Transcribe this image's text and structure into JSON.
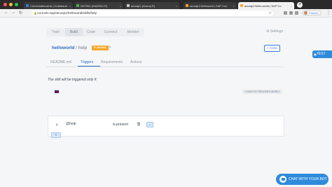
{
  "browser": {
    "tabs": [
      {
        "title": "Conversational AI | Collaborat",
        "color": "#3a7bd5"
      },
      {
        "title": "I327904 (ANURAJ R)",
        "color": "#4caf50"
      },
      {
        "title": "anurajr1 (Anuraj R)",
        "color": "#cccccc"
      },
      {
        "title": "anurajr1/helloworld | SAP Con",
        "color": "#f4a72a"
      },
      {
        "title": "anurajr1/hello-world | SAP Co",
        "color": "#f4a72a"
      }
    ],
    "active_tab": 4,
    "url": "cai.tools.sap/anurajr1/helloworld/skills/help",
    "profile_label": "Paused",
    "new_tab": "+"
  },
  "nav": {
    "tabs": [
      "Train",
      "Build",
      "Code",
      "Connect",
      "Monitor"
    ],
    "active": "Build",
    "settings_label": "Settings"
  },
  "skill": {
    "bot_name": "helloworld",
    "separator": " / ",
    "skill_name": "help",
    "badge": "FLOATING",
    "fork_label": "⑂ FORK"
  },
  "test_label": "TEST",
  "subtabs": {
    "items": [
      "README.md",
      "Triggers",
      "Requirements",
      "Actions"
    ],
    "active": "Triggers"
  },
  "triggers": {
    "description": "The skill will be triggered only if:",
    "help_label": "HOW DO TRIGGERS WORK?",
    "condition": {
      "keyword": "if",
      "field": "@help",
      "operator": "is-present",
      "select_label": "⌄"
    },
    "add_label": "+"
  },
  "chat_label": "CHAT WITH YOUR BOT",
  "colors": {
    "accent": "#2f8bdb",
    "link": "#2d6cc0",
    "badge": "#f4a72a"
  }
}
